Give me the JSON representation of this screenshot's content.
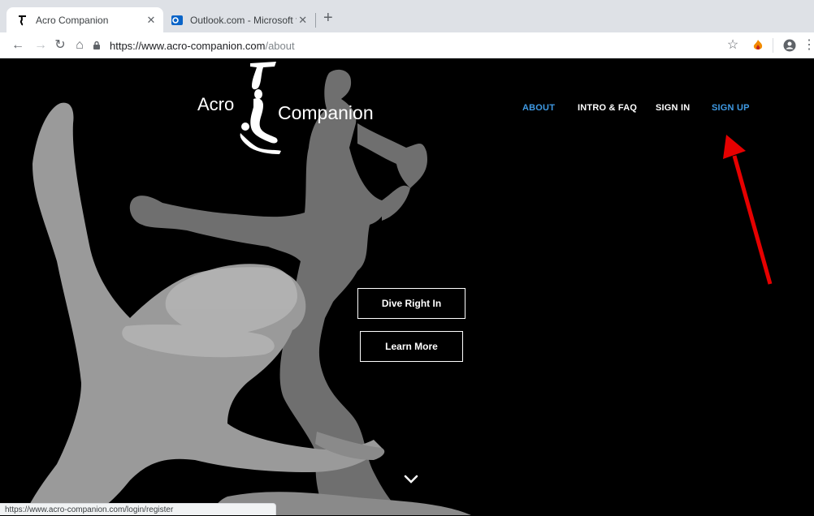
{
  "browser": {
    "tabs": [
      {
        "title": "Acro Companion",
        "active": true
      },
      {
        "title": "Outlook.com - Microsoft free p",
        "active": false
      }
    ],
    "url_host": "https://www.acro-companion.com",
    "url_path": "/about",
    "status_url": "https://www.acro-companion.com/login/register"
  },
  "site": {
    "logo_left": "Acro",
    "logo_right": "Companion",
    "nav": [
      {
        "label": "ABOUT",
        "active": true
      },
      {
        "label": "INTRO & FAQ",
        "active": false
      },
      {
        "label": "SIGN IN",
        "active": false
      },
      {
        "label": "SIGN UP",
        "active": true
      }
    ],
    "buttons": {
      "dive": "Dive Right In",
      "learn": "Learn More"
    }
  },
  "colors": {
    "nav_active": "#3f9ae4",
    "annotation_arrow": "#e60000",
    "background": "#000000"
  },
  "icons": [
    "back-arrow-icon",
    "forward-arrow-icon",
    "reload-icon",
    "home-icon",
    "lock-icon",
    "star-icon",
    "extension-icon",
    "profile-icon",
    "menu-icon",
    "chevron-down-icon"
  ]
}
